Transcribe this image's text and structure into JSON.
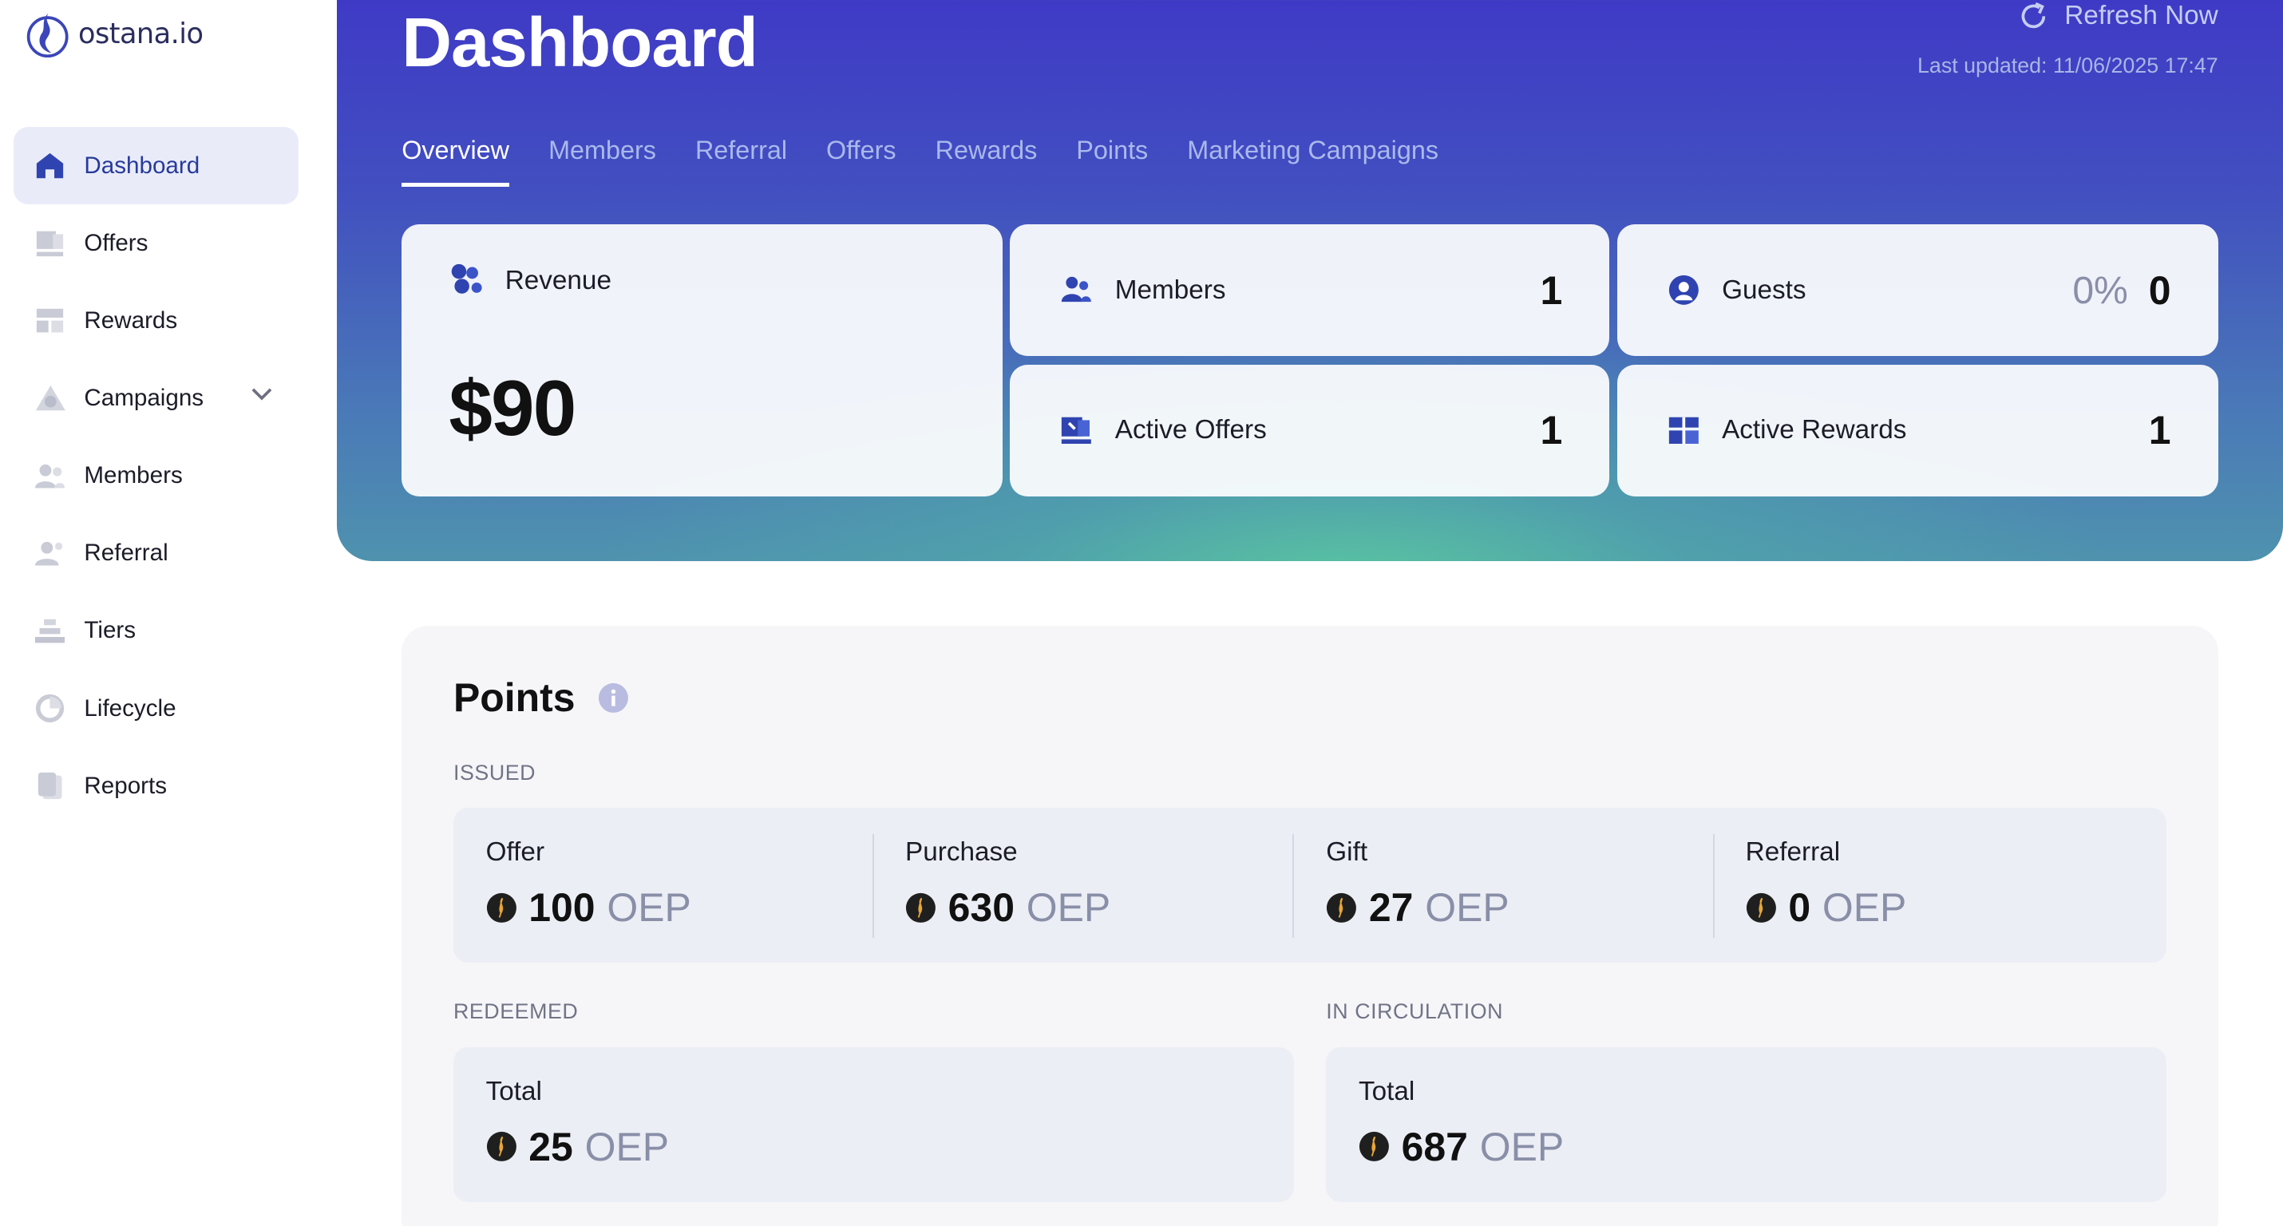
{
  "brand": {
    "name": "ostana.io"
  },
  "sidebar": {
    "items": [
      {
        "label": "Dashboard",
        "icon": "home-icon"
      },
      {
        "label": "Offers",
        "icon": "offers-icon"
      },
      {
        "label": "Rewards",
        "icon": "rewards-icon"
      },
      {
        "label": "Campaigns",
        "icon": "campaigns-icon"
      },
      {
        "label": "Members",
        "icon": "members-icon"
      },
      {
        "label": "Referral",
        "icon": "referral-icon"
      },
      {
        "label": "Tiers",
        "icon": "tiers-icon"
      },
      {
        "label": "Lifecycle",
        "icon": "lifecycle-icon"
      },
      {
        "label": "Reports",
        "icon": "reports-icon"
      }
    ]
  },
  "header": {
    "title": "Dashboard",
    "refresh_label": "Refresh Now",
    "last_updated": "Last updated: 11/06/2025 17:47"
  },
  "tabs": [
    "Overview",
    "Members",
    "Referral",
    "Offers",
    "Rewards",
    "Points",
    "Marketing Campaigns"
  ],
  "cards": {
    "revenue": {
      "label": "Revenue",
      "value": "$90"
    },
    "members": {
      "label": "Members",
      "value": "1"
    },
    "guests": {
      "label": "Guests",
      "percent": "0%",
      "value": "0"
    },
    "active_offers": {
      "label": "Active Offers",
      "value": "1"
    },
    "active_rewards": {
      "label": "Active Rewards",
      "value": "1"
    }
  },
  "points": {
    "title": "Points",
    "issued_label": "ISSUED",
    "issued": [
      {
        "label": "Offer",
        "value": "100",
        "unit": "OEP"
      },
      {
        "label": "Purchase",
        "value": "630",
        "unit": "OEP"
      },
      {
        "label": "Gift",
        "value": "27",
        "unit": "OEP"
      },
      {
        "label": "Referral",
        "value": "0",
        "unit": "OEP"
      }
    ],
    "redeemed_label": "REDEEMED",
    "redeemed": {
      "label": "Total",
      "value": "25",
      "unit": "OEP"
    },
    "circulation_label": "IN CIRCULATION",
    "circulation": {
      "label": "Total",
      "value": "687",
      "unit": "OEP"
    }
  },
  "colors": {
    "accent": "#283a9c",
    "hero_top": "#3f3ac6",
    "hero_glow": "#5ac8a0",
    "coin": "#1f1f1f"
  }
}
